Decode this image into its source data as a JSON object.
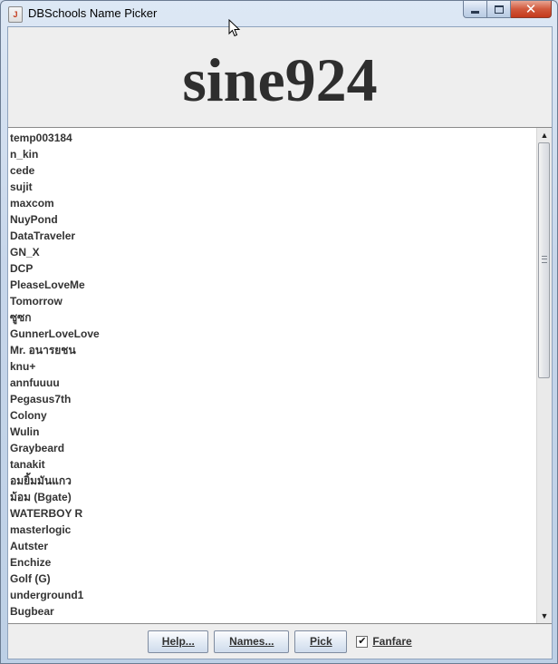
{
  "window": {
    "title": "DBSchools Name Picker",
    "icon": "java-icon",
    "close_symbol": "✕"
  },
  "banner": {
    "picked_name": "sine924"
  },
  "names": [
    "temp003184",
    "n_kin",
    "cede",
    "sujit",
    "maxcom",
    "NuyPond",
    "DataTraveler",
    "GN_X",
    "DCP",
    "PleaseLoveMe",
    "Tomorrow",
    "ซูซก",
    "GunnerLoveLove",
    "Mr. อนารยชน",
    "knu+",
    "annfuuuu",
    "Pegasus7th",
    "Colony",
    "Wulin",
    "Graybeard",
    "tanakit",
    "อมยิ้มมันแกว",
    "ม้อม (Bgate)",
    "WATERBOY R",
    "masterlogic",
    "Autster",
    "Enchize",
    "Golf (G)",
    "underground1",
    "Bugbear"
  ],
  "scrollbar": {
    "up_arrow": "▲",
    "down_arrow": "▼"
  },
  "toolbar": {
    "help_label": "Help...",
    "names_label": "Names...",
    "pick_label": "Pick",
    "fanfare_label": "Fanfare",
    "fanfare_checked": true,
    "check_mark": "✔"
  }
}
